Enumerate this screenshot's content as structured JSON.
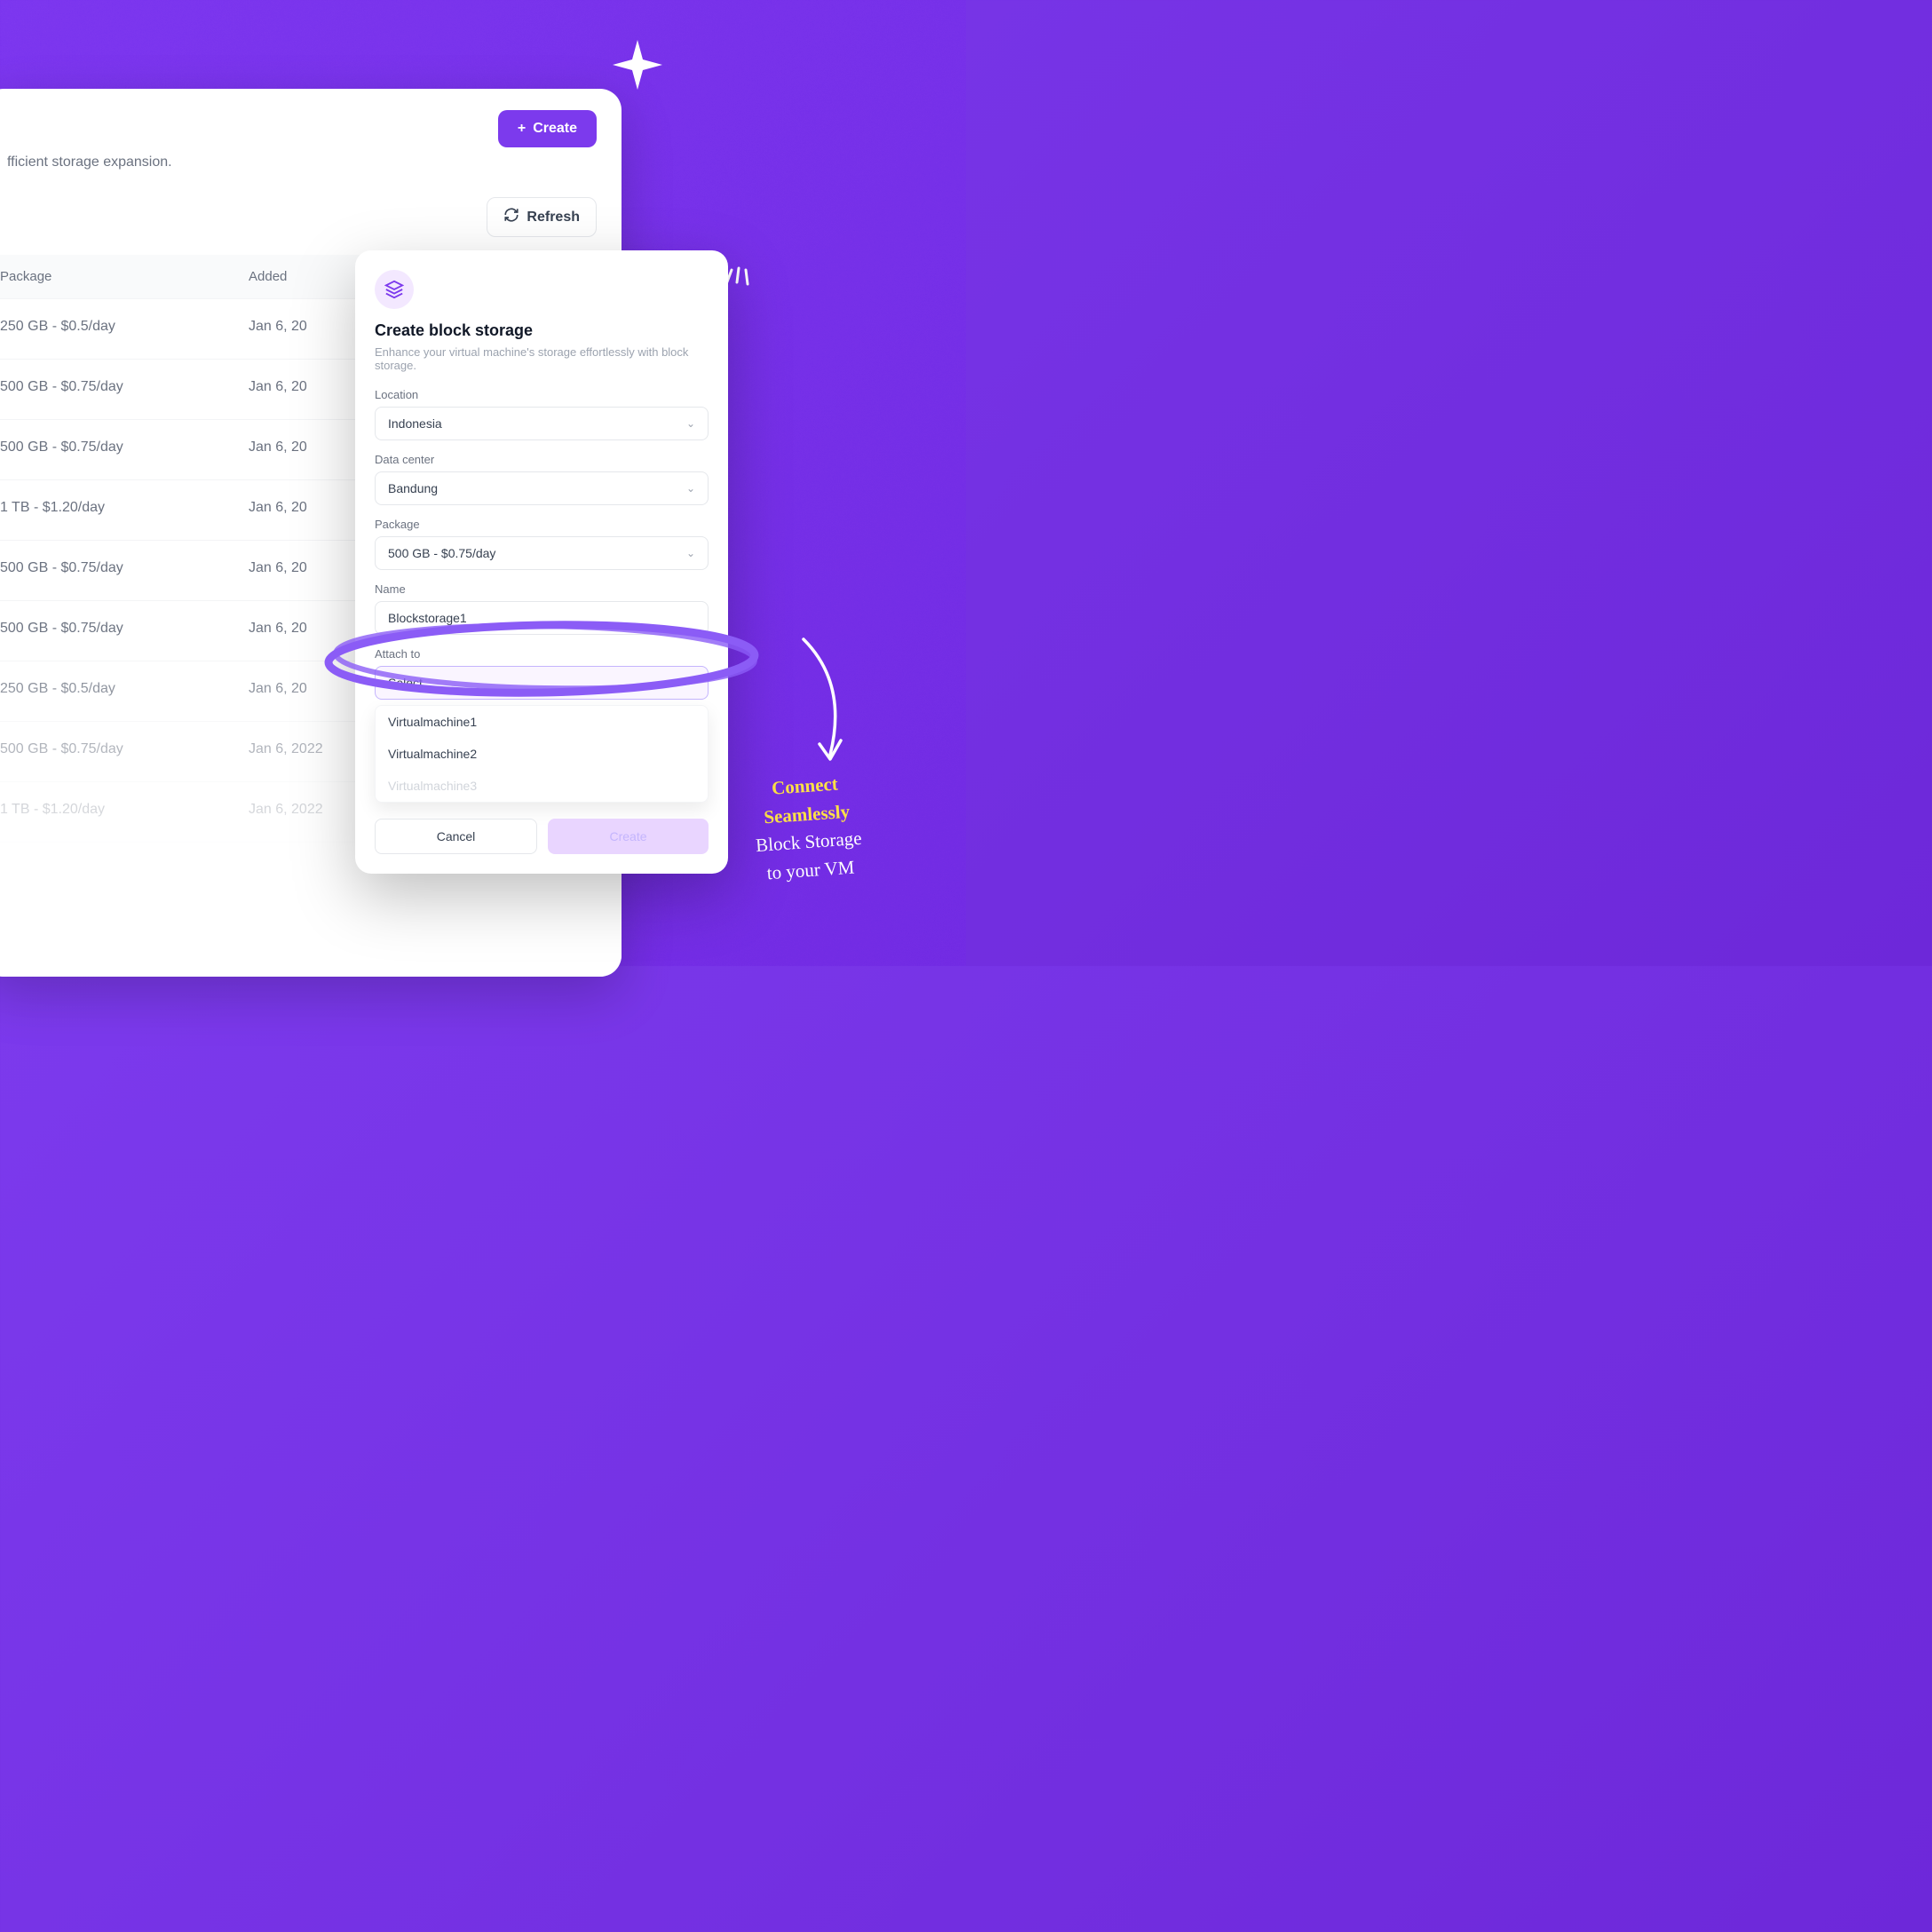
{
  "panel": {
    "subtitle": "fficient storage expansion.",
    "create_label": "Create",
    "refresh_label": "Refresh"
  },
  "table": {
    "col_package": "Package",
    "col_added": "Added",
    "rows": [
      {
        "package": "250 GB - $0.5/day",
        "added": "Jan 6, 20"
      },
      {
        "package": "500 GB - $0.75/day",
        "added": "Jan 6, 20"
      },
      {
        "package": "500 GB - $0.75/day",
        "added": "Jan 6, 20"
      },
      {
        "package": "1 TB - $1.20/day",
        "added": "Jan 6, 20"
      },
      {
        "package": "500 GB - $0.75/day",
        "added": "Jan 6, 20"
      },
      {
        "package": "500 GB - $0.75/day",
        "added": "Jan 6, 20"
      },
      {
        "package": "250 GB - $0.5/day",
        "added": "Jan 6, 20"
      },
      {
        "package": "500 GB - $0.75/day",
        "added": "Jan 6, 2022"
      },
      {
        "package": "1 TB - $1.20/day",
        "added": "Jan 6, 2022"
      }
    ]
  },
  "modal": {
    "title": "Create block storage",
    "desc": "Enhance your virtual machine's storage effortlessly with block storage.",
    "location_label": "Location",
    "location_value": "Indonesia",
    "datacenter_label": "Data center",
    "datacenter_value": "Bandung",
    "package_label": "Package",
    "package_value": "500 GB - $0.75/day",
    "name_label": "Name",
    "name_value": "Blockstorage1",
    "attach_label": "Attach to",
    "attach_placeholder": "Select",
    "options": [
      "Virtualmachine1",
      "Virtualmachine2",
      "Virtualmachine3"
    ],
    "cancel": "Cancel",
    "create": "Create"
  },
  "annotation": {
    "line1": "Connect",
    "line2": "Seamlessly",
    "line3": "Block Storage",
    "line4": "to your VM"
  }
}
